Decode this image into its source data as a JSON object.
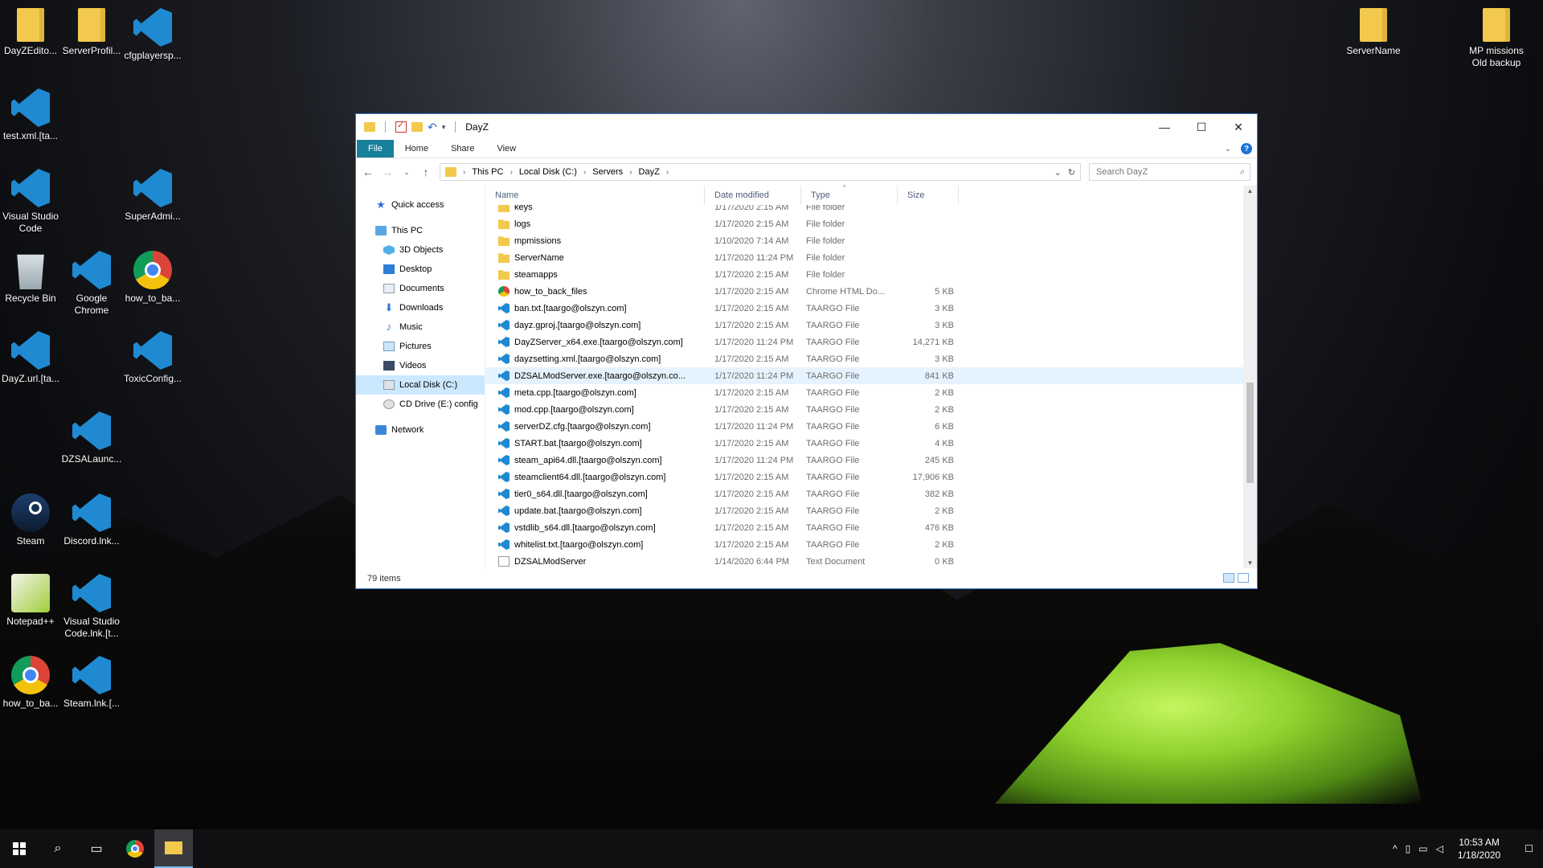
{
  "desktop": {
    "icons": [
      {
        "label": "DayZEdito...",
        "type": "folder"
      },
      {
        "label": "ServerProfil...",
        "type": "folder"
      },
      {
        "label": "cfgplayersp...",
        "type": "vscode"
      },
      {
        "label": "test.xml.[ta...",
        "type": "vscode"
      },
      {
        "label": "Visual Studio Code",
        "type": "vscode"
      },
      {
        "label": "SuperAdmi...",
        "type": "vscode"
      },
      {
        "label": "Recycle Bin",
        "type": "bin"
      },
      {
        "label": "Google Chrome",
        "type": "vscode"
      },
      {
        "label": "how_to_ba...",
        "type": "chrome"
      },
      {
        "label": "DayZ.url.[ta...",
        "type": "vscode"
      },
      {
        "label": "ToxicConfig...",
        "type": "vscode"
      },
      {
        "label": "DZSALaunc...",
        "type": "vscode"
      },
      {
        "label": "Steam",
        "type": "steam"
      },
      {
        "label": "Discord.lnk...",
        "type": "vscode"
      },
      {
        "label": "Notepad++",
        "type": "notepad"
      },
      {
        "label": "Visual Studio Code.lnk.[t...",
        "type": "vscode"
      },
      {
        "label": "how_to_ba...",
        "type": "chrome"
      },
      {
        "label": "Steam.lnk.[...",
        "type": "vscode"
      },
      {
        "label": "ServerName",
        "type": "folder"
      },
      {
        "label": "MP missions Old backup",
        "type": "folder"
      }
    ]
  },
  "window": {
    "title": "DayZ",
    "ribbon_tabs": {
      "file": "File",
      "home": "Home",
      "share": "Share",
      "view": "View"
    },
    "help": "?",
    "address": {
      "crumbs": [
        "This PC",
        "Local Disk (C:)",
        "Servers",
        "DayZ"
      ]
    },
    "search_placeholder": "Search DayZ",
    "nav": {
      "quick_access": "Quick access",
      "this_pc": "This PC",
      "objects3d": "3D Objects",
      "desktop": "Desktop",
      "documents": "Documents",
      "downloads": "Downloads",
      "music": "Music",
      "pictures": "Pictures",
      "videos": "Videos",
      "local_disk": "Local Disk (C:)",
      "cd_drive": "CD Drive (E:) config",
      "network": "Network"
    },
    "columns": {
      "name": "Name",
      "date": "Date modified",
      "type": "Type",
      "size": "Size"
    },
    "files": [
      {
        "name": "keys",
        "date": "1/17/2020 2:15 AM",
        "type": "File folder",
        "size": "",
        "icon": "folder"
      },
      {
        "name": "logs",
        "date": "1/17/2020 2:15 AM",
        "type": "File folder",
        "size": "",
        "icon": "folder"
      },
      {
        "name": "mpmissions",
        "date": "1/10/2020 7:14 AM",
        "type": "File folder",
        "size": "",
        "icon": "folder"
      },
      {
        "name": "ServerName",
        "date": "1/17/2020 11:24 PM",
        "type": "File folder",
        "size": "",
        "icon": "folder"
      },
      {
        "name": "steamapps",
        "date": "1/17/2020 2:15 AM",
        "type": "File folder",
        "size": "",
        "icon": "folder"
      },
      {
        "name": "how_to_back_files",
        "date": "1/17/2020 2:15 AM",
        "type": "Chrome HTML Do...",
        "size": "5 KB",
        "icon": "chrome"
      },
      {
        "name": "ban.txt.[taargo@olszyn.com]",
        "date": "1/17/2020 2:15 AM",
        "type": "TAARGO File",
        "size": "3 KB",
        "icon": "vs"
      },
      {
        "name": "dayz.gproj.[taargo@olszyn.com]",
        "date": "1/17/2020 2:15 AM",
        "type": "TAARGO File",
        "size": "3 KB",
        "icon": "vs"
      },
      {
        "name": "DayZServer_x64.exe.[taargo@olszyn.com]",
        "date": "1/17/2020 11:24 PM",
        "type": "TAARGO File",
        "size": "14,271 KB",
        "icon": "vs"
      },
      {
        "name": "dayzsetting.xml.[taargo@olszyn.com]",
        "date": "1/17/2020 2:15 AM",
        "type": "TAARGO File",
        "size": "3 KB",
        "icon": "vs"
      },
      {
        "name": "DZSALModServer.exe.[taargo@olszyn.co...",
        "date": "1/17/2020 11:24 PM",
        "type": "TAARGO File",
        "size": "841 KB",
        "icon": "vs",
        "selected": true
      },
      {
        "name": "meta.cpp.[taargo@olszyn.com]",
        "date": "1/17/2020 2:15 AM",
        "type": "TAARGO File",
        "size": "2 KB",
        "icon": "vs"
      },
      {
        "name": "mod.cpp.[taargo@olszyn.com]",
        "date": "1/17/2020 2:15 AM",
        "type": "TAARGO File",
        "size": "2 KB",
        "icon": "vs"
      },
      {
        "name": "serverDZ.cfg.[taargo@olszyn.com]",
        "date": "1/17/2020 11:24 PM",
        "type": "TAARGO File",
        "size": "6 KB",
        "icon": "vs"
      },
      {
        "name": "START.bat.[taargo@olszyn.com]",
        "date": "1/17/2020 2:15 AM",
        "type": "TAARGO File",
        "size": "4 KB",
        "icon": "vs"
      },
      {
        "name": "steam_api64.dll.[taargo@olszyn.com]",
        "date": "1/17/2020 11:24 PM",
        "type": "TAARGO File",
        "size": "245 KB",
        "icon": "vs"
      },
      {
        "name": "steamclient64.dll.[taargo@olszyn.com]",
        "date": "1/17/2020 2:15 AM",
        "type": "TAARGO File",
        "size": "17,906 KB",
        "icon": "vs"
      },
      {
        "name": "tier0_s64.dll.[taargo@olszyn.com]",
        "date": "1/17/2020 2:15 AM",
        "type": "TAARGO File",
        "size": "382 KB",
        "icon": "vs"
      },
      {
        "name": "update.bat.[taargo@olszyn.com]",
        "date": "1/17/2020 2:15 AM",
        "type": "TAARGO File",
        "size": "2 KB",
        "icon": "vs"
      },
      {
        "name": "vstdlib_s64.dll.[taargo@olszyn.com]",
        "date": "1/17/2020 2:15 AM",
        "type": "TAARGO File",
        "size": "476 KB",
        "icon": "vs"
      },
      {
        "name": "whitelist.txt.[taargo@olszyn.com]",
        "date": "1/17/2020 2:15 AM",
        "type": "TAARGO File",
        "size": "2 KB",
        "icon": "vs"
      },
      {
        "name": "DZSALModServer",
        "date": "1/14/2020 6:44 PM",
        "type": "Text Document",
        "size": "0 KB",
        "icon": "txt"
      }
    ],
    "status": "79 items",
    "scroll_position": 0.72
  },
  "taskbar": {
    "time": "10:53 AM",
    "date": "1/18/2020"
  },
  "colors": {
    "accent": "#19809b",
    "selection": "#cce8ff",
    "taskbar": "#101013"
  }
}
